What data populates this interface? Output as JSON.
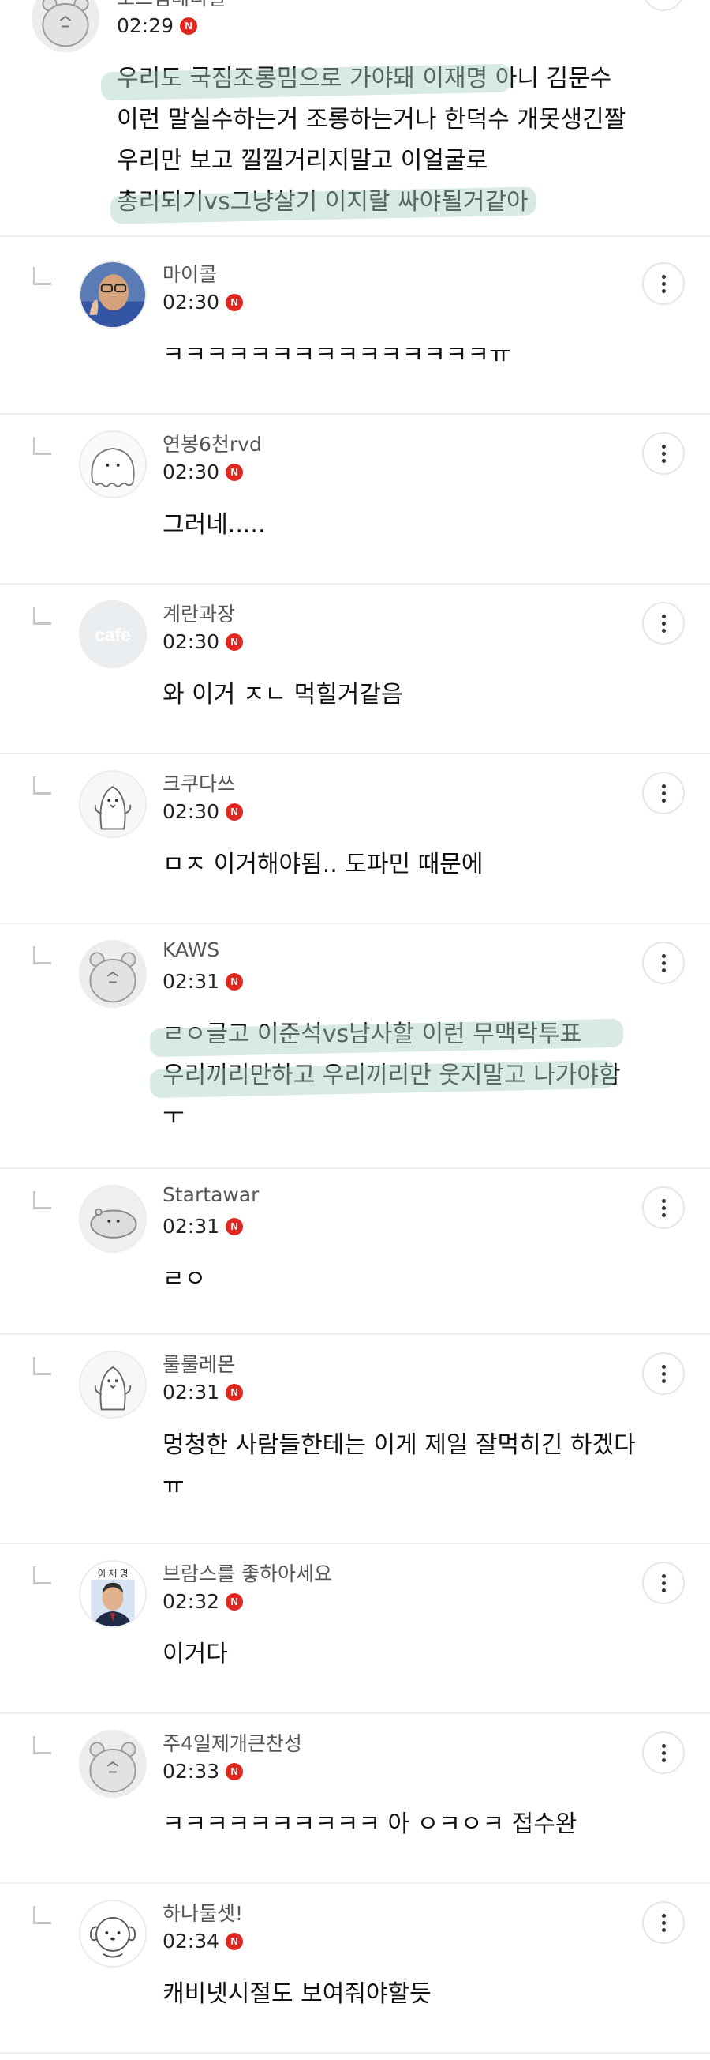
{
  "comments": [
    {
      "nickname": "오드림테디얼",
      "time": "02:29",
      "badge": "N",
      "avatar": "bear-avatar",
      "is_reply": false,
      "lines": [
        "우리도 국짐조롱밈으로 가야돼 이재명 아니 김문수",
        "이런 말실수하는거 조롱하는거나 한덕수 개못생긴짤",
        "우리만 보고 낄낄거리지말고 이얼굴로",
        "총리되기vs그냥살기 이지랄 싸야될거같아"
      ]
    },
    {
      "nickname": "마이콜",
      "time": "02:30",
      "badge": "N",
      "avatar": "photo-avatar",
      "is_reply": true,
      "lines": [
        "ㅋㅋㅋㅋㅋㅋㅋㅋㅋㅋㅋㅋㅋㅋㅋㅠ"
      ]
    },
    {
      "nickname": "연봉6천rvd",
      "time": "02:30",
      "badge": "N",
      "avatar": "blob-avatar",
      "is_reply": true,
      "lines": [
        "그러네....."
      ]
    },
    {
      "nickname": "계란과장",
      "time": "02:30",
      "badge": "N",
      "avatar": "cafe-avatar",
      "avatar_text": "cafe",
      "is_reply": true,
      "lines": [
        "와 이거 ㅈㄴ 먹힐거같음"
      ]
    },
    {
      "nickname": "크쿠다쓰",
      "time": "02:30",
      "badge": "N",
      "avatar": "penguin-avatar",
      "is_reply": true,
      "lines": [
        "ㅁㅈ 이거해야됨.. 도파민 때문에"
      ]
    },
    {
      "nickname": "KAWS",
      "time": "02:31",
      "badge": "N",
      "avatar": "bear-avatar",
      "is_reply": true,
      "lines": [
        "ㄹㅇ글고 이준석vs남사할 이런 무맥락투표",
        "우리끼리만하고 우리끼리만 웃지말고 나가야함",
        "ㅜ"
      ]
    },
    {
      "nickname": "Startawar",
      "time": "02:31",
      "badge": "N",
      "avatar": "seal-avatar",
      "is_reply": true,
      "lines": [
        "ㄹㅇ"
      ]
    },
    {
      "nickname": "룰룰레몬",
      "time": "02:31",
      "badge": "N",
      "avatar": "penguin-avatar",
      "is_reply": true,
      "lines": [
        "멍청한 사람들한테는 이게 제일 잘먹히긴 하겠다",
        "ㅠ"
      ]
    },
    {
      "nickname": "브람스를 좋하아세요",
      "time": "02:32",
      "badge": "N",
      "avatar": "portrait-avatar",
      "avatar_text": "이 재 명",
      "is_reply": true,
      "lines": [
        "이거다"
      ]
    },
    {
      "nickname": "주4일제개큰찬성",
      "time": "02:33",
      "badge": "N",
      "avatar": "bear-avatar",
      "is_reply": true,
      "lines": [
        "ㅋㅋㅋㅋㅋㅋㅋㅋㅋㅋ 아 ㅇㅋㅇㅋ 접수완"
      ]
    },
    {
      "nickname": "하나둘셋!",
      "time": "02:34",
      "badge": "N",
      "avatar": "dog-avatar",
      "is_reply": true,
      "lines": [
        "캐비넷시절도 보여줘야할듯"
      ]
    }
  ],
  "colors": {
    "badge": "#e0271f",
    "highlight": "#a7d1c4",
    "divider": "#eeeeee",
    "nickname": "#555555"
  }
}
